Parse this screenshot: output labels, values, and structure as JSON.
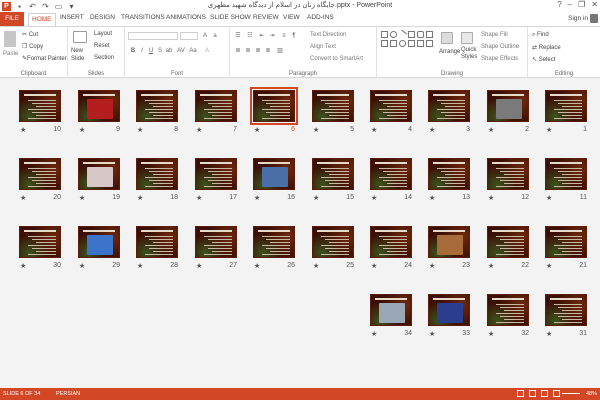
{
  "window": {
    "title": "جایگاه زنان در اسلام از دیدگاه شهید مطهری.pptx - PowerPoint",
    "app_icon_label": "P",
    "minimize": "–",
    "restore": "❐",
    "close": "✕",
    "help": "?"
  },
  "tabs": {
    "file": "FILE",
    "items": [
      "HOME",
      "INSERT",
      "DESIGN",
      "TRANSITIONS",
      "ANIMATIONS",
      "SLIDE SHOW",
      "REVIEW",
      "VIEW",
      "ADD-INS"
    ],
    "signin": "Sign in"
  },
  "ribbon": {
    "clipboard": {
      "label": "Clipboard",
      "paste": "Paste",
      "cut": "Cut",
      "copy": "Copy",
      "format_painter": "Format Painter"
    },
    "slides": {
      "label": "Slides",
      "new_slide": "New Slide",
      "layout": "Layout",
      "reset": "Reset",
      "section": "Section"
    },
    "font": {
      "label": "Font"
    },
    "paragraph": {
      "label": "Paragraph",
      "text_direction": "Text Direction",
      "align_text": "Align Text",
      "convert_smartart": "Convert to SmartArt"
    },
    "drawing": {
      "label": "Drawing",
      "arrange": "Arrange",
      "quick_styles": "Quick Styles",
      "shape_fill": "Shape Fill",
      "shape_outline": "Shape Outline",
      "shape_effects": "Shape Effects"
    },
    "editing": {
      "label": "Editing",
      "find": "Find",
      "replace": "Replace",
      "select": "Select"
    }
  },
  "slides": [
    {
      "n": "1",
      "img": false
    },
    {
      "n": "2",
      "img": true,
      "img_color": "#7a7a7a"
    },
    {
      "n": "3",
      "img": false
    },
    {
      "n": "4",
      "img": false
    },
    {
      "n": "5",
      "img": false
    },
    {
      "n": "6",
      "img": false,
      "selected": true
    },
    {
      "n": "7",
      "img": false
    },
    {
      "n": "8",
      "img": false
    },
    {
      "n": "9",
      "img": true,
      "img_color": "#b41e1e"
    },
    {
      "n": "10",
      "img": false
    },
    {
      "n": "11",
      "img": false
    },
    {
      "n": "12",
      "img": false
    },
    {
      "n": "13",
      "img": false
    },
    {
      "n": "14",
      "img": false
    },
    {
      "n": "15",
      "img": false
    },
    {
      "n": "16",
      "img": true,
      "img_color": "#4a6fa8"
    },
    {
      "n": "17",
      "img": false
    },
    {
      "n": "18",
      "img": false
    },
    {
      "n": "19",
      "img": true,
      "img_color": "#d8c7c7"
    },
    {
      "n": "20",
      "img": false
    },
    {
      "n": "21",
      "img": false
    },
    {
      "n": "22",
      "img": false
    },
    {
      "n": "23",
      "img": true,
      "img_color": "#a86b3a"
    },
    {
      "n": "24",
      "img": false
    },
    {
      "n": "25",
      "img": false
    },
    {
      "n": "26",
      "img": false
    },
    {
      "n": "27",
      "img": false
    },
    {
      "n": "28",
      "img": false
    },
    {
      "n": "29",
      "img": true,
      "img_color": "#3b74c9"
    },
    {
      "n": "30",
      "img": false
    },
    {
      "n": "31",
      "img": false
    },
    {
      "n": "32",
      "img": false
    },
    {
      "n": "33",
      "img": true,
      "img_color": "#2a3d8f"
    },
    {
      "n": "34",
      "img": true,
      "img_color": "#9aa7b5"
    }
  ],
  "status": {
    "slide": "SLIDE 6 OF 34",
    "language": "PERSIAN",
    "zoom": "48%"
  },
  "colors": {
    "accent": "#d24726",
    "slide_bg": "#3b0f05"
  }
}
